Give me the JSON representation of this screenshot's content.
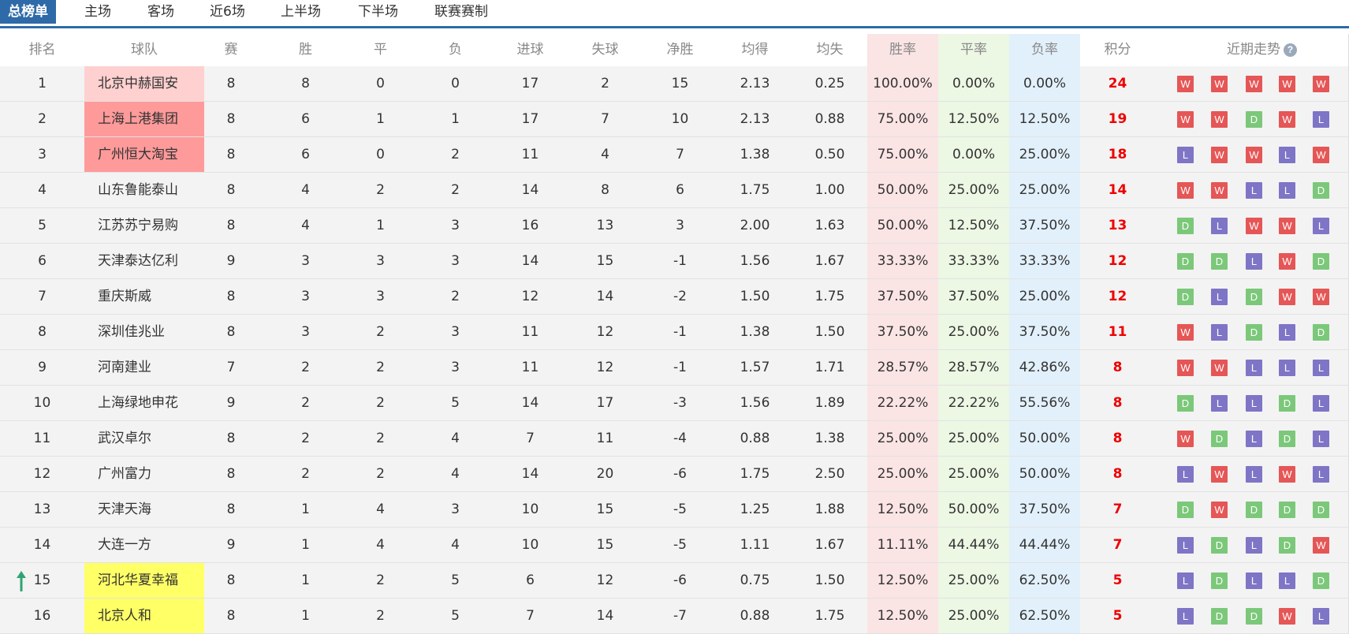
{
  "tabs": [
    "总榜单",
    "主场",
    "客场",
    "近6场",
    "上半场",
    "下半场",
    "联赛赛制"
  ],
  "headers": {
    "rank": "排名",
    "team": "球队",
    "played": "赛",
    "win": "胜",
    "draw": "平",
    "loss": "负",
    "gf": "进球",
    "ga": "失球",
    "gd": "净胜",
    "avg_gf": "均得",
    "avg_ga": "均失",
    "win_rate": "胜率",
    "draw_rate": "平率",
    "loss_rate": "负率",
    "points": "积分",
    "form": "近期走势"
  },
  "colors": {
    "tab_active": "#2e6aa7",
    "W": "#e55656",
    "D": "#7cc87a",
    "L": "#7e75c6",
    "champions": "#ffd0d0",
    "acl": "#ff9a9a",
    "relegation": "#ffff66",
    "points": "#e00000",
    "up_arrow": "#2fa472"
  },
  "rows": [
    {
      "rank": "1",
      "team": "北京中赫国安",
      "played": "8",
      "win": "8",
      "draw": "0",
      "loss": "0",
      "gf": "17",
      "ga": "2",
      "gd": "15",
      "avg_gf": "2.13",
      "avg_ga": "0.25",
      "win_rate": "100.00%",
      "draw_rate": "0.00%",
      "loss_rate": "0.00%",
      "points": "24",
      "form": [
        "W",
        "W",
        "W",
        "W",
        "W"
      ],
      "highlight": "champions"
    },
    {
      "rank": "2",
      "team": "上海上港集团",
      "played": "8",
      "win": "6",
      "draw": "1",
      "loss": "1",
      "gf": "17",
      "ga": "7",
      "gd": "10",
      "avg_gf": "2.13",
      "avg_ga": "0.88",
      "win_rate": "75.00%",
      "draw_rate": "12.50%",
      "loss_rate": "12.50%",
      "points": "19",
      "form": [
        "W",
        "W",
        "D",
        "W",
        "L"
      ],
      "highlight": "acl"
    },
    {
      "rank": "3",
      "team": "广州恒大淘宝",
      "played": "8",
      "win": "6",
      "draw": "0",
      "loss": "2",
      "gf": "11",
      "ga": "4",
      "gd": "7",
      "avg_gf": "1.38",
      "avg_ga": "0.50",
      "win_rate": "75.00%",
      "draw_rate": "0.00%",
      "loss_rate": "25.00%",
      "points": "18",
      "form": [
        "L",
        "W",
        "W",
        "L",
        "W"
      ],
      "highlight": "acl"
    },
    {
      "rank": "4",
      "team": "山东鲁能泰山",
      "played": "8",
      "win": "4",
      "draw": "2",
      "loss": "2",
      "gf": "14",
      "ga": "8",
      "gd": "6",
      "avg_gf": "1.75",
      "avg_ga": "1.00",
      "win_rate": "50.00%",
      "draw_rate": "25.00%",
      "loss_rate": "25.00%",
      "points": "14",
      "form": [
        "W",
        "W",
        "L",
        "L",
        "D"
      ],
      "highlight": ""
    },
    {
      "rank": "5",
      "team": "江苏苏宁易购",
      "played": "8",
      "win": "4",
      "draw": "1",
      "loss": "3",
      "gf": "16",
      "ga": "13",
      "gd": "3",
      "avg_gf": "2.00",
      "avg_ga": "1.63",
      "win_rate": "50.00%",
      "draw_rate": "12.50%",
      "loss_rate": "37.50%",
      "points": "13",
      "form": [
        "D",
        "L",
        "W",
        "W",
        "L"
      ],
      "highlight": ""
    },
    {
      "rank": "6",
      "team": "天津泰达亿利",
      "played": "9",
      "win": "3",
      "draw": "3",
      "loss": "3",
      "gf": "14",
      "ga": "15",
      "gd": "-1",
      "avg_gf": "1.56",
      "avg_ga": "1.67",
      "win_rate": "33.33%",
      "draw_rate": "33.33%",
      "loss_rate": "33.33%",
      "points": "12",
      "form": [
        "D",
        "D",
        "L",
        "W",
        "D"
      ],
      "highlight": ""
    },
    {
      "rank": "7",
      "team": "重庆斯威",
      "played": "8",
      "win": "3",
      "draw": "3",
      "loss": "2",
      "gf": "12",
      "ga": "14",
      "gd": "-2",
      "avg_gf": "1.50",
      "avg_ga": "1.75",
      "win_rate": "37.50%",
      "draw_rate": "37.50%",
      "loss_rate": "25.00%",
      "points": "12",
      "form": [
        "D",
        "L",
        "D",
        "W",
        "W"
      ],
      "highlight": ""
    },
    {
      "rank": "8",
      "team": "深圳佳兆业",
      "played": "8",
      "win": "3",
      "draw": "2",
      "loss": "3",
      "gf": "11",
      "ga": "12",
      "gd": "-1",
      "avg_gf": "1.38",
      "avg_ga": "1.50",
      "win_rate": "37.50%",
      "draw_rate": "25.00%",
      "loss_rate": "37.50%",
      "points": "11",
      "form": [
        "W",
        "L",
        "D",
        "L",
        "D"
      ],
      "highlight": ""
    },
    {
      "rank": "9",
      "team": "河南建业",
      "played": "7",
      "win": "2",
      "draw": "2",
      "loss": "3",
      "gf": "11",
      "ga": "12",
      "gd": "-1",
      "avg_gf": "1.57",
      "avg_ga": "1.71",
      "win_rate": "28.57%",
      "draw_rate": "28.57%",
      "loss_rate": "42.86%",
      "points": "8",
      "form": [
        "W",
        "W",
        "L",
        "L",
        "L"
      ],
      "highlight": ""
    },
    {
      "rank": "10",
      "team": "上海绿地申花",
      "played": "9",
      "win": "2",
      "draw": "2",
      "loss": "5",
      "gf": "14",
      "ga": "17",
      "gd": "-3",
      "avg_gf": "1.56",
      "avg_ga": "1.89",
      "win_rate": "22.22%",
      "draw_rate": "22.22%",
      "loss_rate": "55.56%",
      "points": "8",
      "form": [
        "D",
        "L",
        "L",
        "D",
        "L"
      ],
      "highlight": ""
    },
    {
      "rank": "11",
      "team": "武汉卓尔",
      "played": "8",
      "win": "2",
      "draw": "2",
      "loss": "4",
      "gf": "7",
      "ga": "11",
      "gd": "-4",
      "avg_gf": "0.88",
      "avg_ga": "1.38",
      "win_rate": "25.00%",
      "draw_rate": "25.00%",
      "loss_rate": "50.00%",
      "points": "8",
      "form": [
        "W",
        "D",
        "L",
        "D",
        "L"
      ],
      "highlight": ""
    },
    {
      "rank": "12",
      "team": "广州富力",
      "played": "8",
      "win": "2",
      "draw": "2",
      "loss": "4",
      "gf": "14",
      "ga": "20",
      "gd": "-6",
      "avg_gf": "1.75",
      "avg_ga": "2.50",
      "win_rate": "25.00%",
      "draw_rate": "25.00%",
      "loss_rate": "50.00%",
      "points": "8",
      "form": [
        "L",
        "W",
        "L",
        "W",
        "L"
      ],
      "highlight": ""
    },
    {
      "rank": "13",
      "team": "天津天海",
      "played": "8",
      "win": "1",
      "draw": "4",
      "loss": "3",
      "gf": "10",
      "ga": "15",
      "gd": "-5",
      "avg_gf": "1.25",
      "avg_ga": "1.88",
      "win_rate": "12.50%",
      "draw_rate": "50.00%",
      "loss_rate": "37.50%",
      "points": "7",
      "form": [
        "D",
        "W",
        "D",
        "D",
        "D"
      ],
      "highlight": ""
    },
    {
      "rank": "14",
      "team": "大连一方",
      "played": "9",
      "win": "1",
      "draw": "4",
      "loss": "4",
      "gf": "10",
      "ga": "15",
      "gd": "-5",
      "avg_gf": "1.11",
      "avg_ga": "1.67",
      "win_rate": "11.11%",
      "draw_rate": "44.44%",
      "loss_rate": "44.44%",
      "points": "7",
      "form": [
        "L",
        "D",
        "L",
        "D",
        "W"
      ],
      "highlight": ""
    },
    {
      "rank": "15",
      "team": "河北华夏幸福",
      "played": "8",
      "win": "1",
      "draw": "2",
      "loss": "5",
      "gf": "6",
      "ga": "12",
      "gd": "-6",
      "avg_gf": "0.75",
      "avg_ga": "1.50",
      "win_rate": "12.50%",
      "draw_rate": "25.00%",
      "loss_rate": "62.50%",
      "points": "5",
      "form": [
        "L",
        "D",
        "L",
        "L",
        "D"
      ],
      "highlight": "relegation",
      "trend": "up"
    },
    {
      "rank": "16",
      "team": "北京人和",
      "played": "8",
      "win": "1",
      "draw": "2",
      "loss": "5",
      "gf": "7",
      "ga": "14",
      "gd": "-7",
      "avg_gf": "0.88",
      "avg_ga": "1.75",
      "win_rate": "12.50%",
      "draw_rate": "25.00%",
      "loss_rate": "62.50%",
      "points": "5",
      "form": [
        "L",
        "D",
        "D",
        "W",
        "L"
      ],
      "highlight": "relegation"
    }
  ]
}
